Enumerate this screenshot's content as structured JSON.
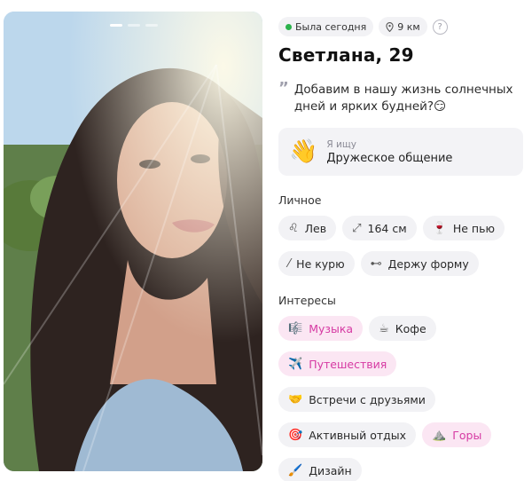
{
  "profile": {
    "status": "Была сегодня",
    "distance": "9 км",
    "help_symbol": "?",
    "name_age": "Светлана, 29",
    "bio_quote_mark": "”",
    "bio": "Добавим в нашу жизнь солнечных дней и ярких будней?😏",
    "seeking_emoji": "👋",
    "seeking_label": "Я ищу",
    "seeking_value": "Дружеское общение"
  },
  "photo": {
    "dots_total": 3,
    "active_index": 0
  },
  "personal": {
    "title": "Личное",
    "items": [
      {
        "icon": "leo-sign-icon",
        "glyph": "♌",
        "label": "Лев"
      },
      {
        "icon": "height-arrows-icon",
        "glyph": "⤢",
        "label": "164 см"
      },
      {
        "icon": "wine-glass-icon",
        "glyph": "🍷",
        "label": "Не пью"
      },
      {
        "icon": "no-smoking-icon",
        "glyph": "⁄",
        "label": "Не курю"
      },
      {
        "icon": "dumbbell-icon",
        "glyph": "⊷",
        "label": "Держу форму"
      }
    ]
  },
  "interests": {
    "title": "Интересы",
    "items": [
      {
        "icon": "music-icon",
        "glyph": "🎼",
        "label": "Музыка",
        "highlighted": true
      },
      {
        "icon": "coffee-icon",
        "glyph": "☕",
        "label": "Кофе",
        "highlighted": false
      },
      {
        "icon": "airplane-icon",
        "glyph": "✈️",
        "label": "Путешествия",
        "highlighted": true
      },
      {
        "icon": "handshake-icon",
        "glyph": "🤝",
        "label": "Встречи с друзьями",
        "highlighted": false
      },
      {
        "icon": "target-icon",
        "glyph": "🎯",
        "label": "Активный отдых",
        "highlighted": false
      },
      {
        "icon": "mountain-icon",
        "glyph": "⛰️",
        "label": "Горы",
        "highlighted": true
      },
      {
        "icon": "paintbrush-icon",
        "glyph": "🖌️",
        "label": "Дизайн",
        "highlighted": false
      }
    ]
  },
  "colors": {
    "online": "#2bb24c",
    "chip_bg": "#f2f2f5",
    "highlight_bg": "#fbe6f3",
    "highlight_text": "#d63aa3"
  }
}
